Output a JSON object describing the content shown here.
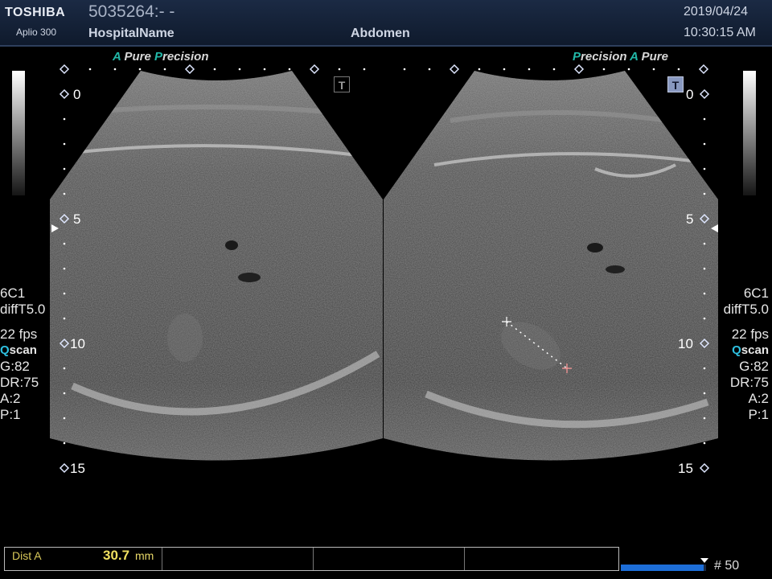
{
  "header": {
    "brand": "TOSHIBA",
    "model": "Aplio 300",
    "patient_id": "5035264:- -",
    "hospital": "HospitalName",
    "exam": "Abdomen",
    "date": "2019/04/24",
    "time": "10:30:15 AM"
  },
  "left_panel": {
    "brand_tag": {
      "a": "A",
      "pure": " Pure ",
      "p": "P",
      "precision": "recision"
    },
    "depth_marks": [
      "0",
      "5",
      "10",
      "15"
    ],
    "params": {
      "probe": "6C1",
      "mode": "diffT5.0",
      "fps": "22 fps",
      "qscan_q": "Q",
      "qscan_rest": "scan",
      "gain": "G:82",
      "dr": "DR:75",
      "a": "A:2",
      "p": "P:1"
    }
  },
  "right_panel": {
    "brand_tag": {
      "p": "P",
      "precision": "recision",
      "a": "A",
      "pure": " Pure"
    },
    "depth_marks": [
      "0",
      "5",
      "10",
      "15"
    ],
    "params": {
      "probe": "6C1",
      "mode": "diffT5.0",
      "fps": "22 fps",
      "qscan_q": "Q",
      "qscan_rest": "scan",
      "gain": "G:82",
      "dr": "DR:75",
      "a": "A:2",
      "p": "P:1"
    }
  },
  "t_marker": "T",
  "measurement": {
    "label": "Dist A",
    "value": "30.7",
    "unit": "mm"
  },
  "frame": {
    "label": "# 50",
    "progress_fraction": 0.97
  },
  "colors": {
    "accent": "#22b8a8",
    "measure": "#f0e060",
    "qscan": "#2ec0e0",
    "progress": "#1d6ed8"
  }
}
